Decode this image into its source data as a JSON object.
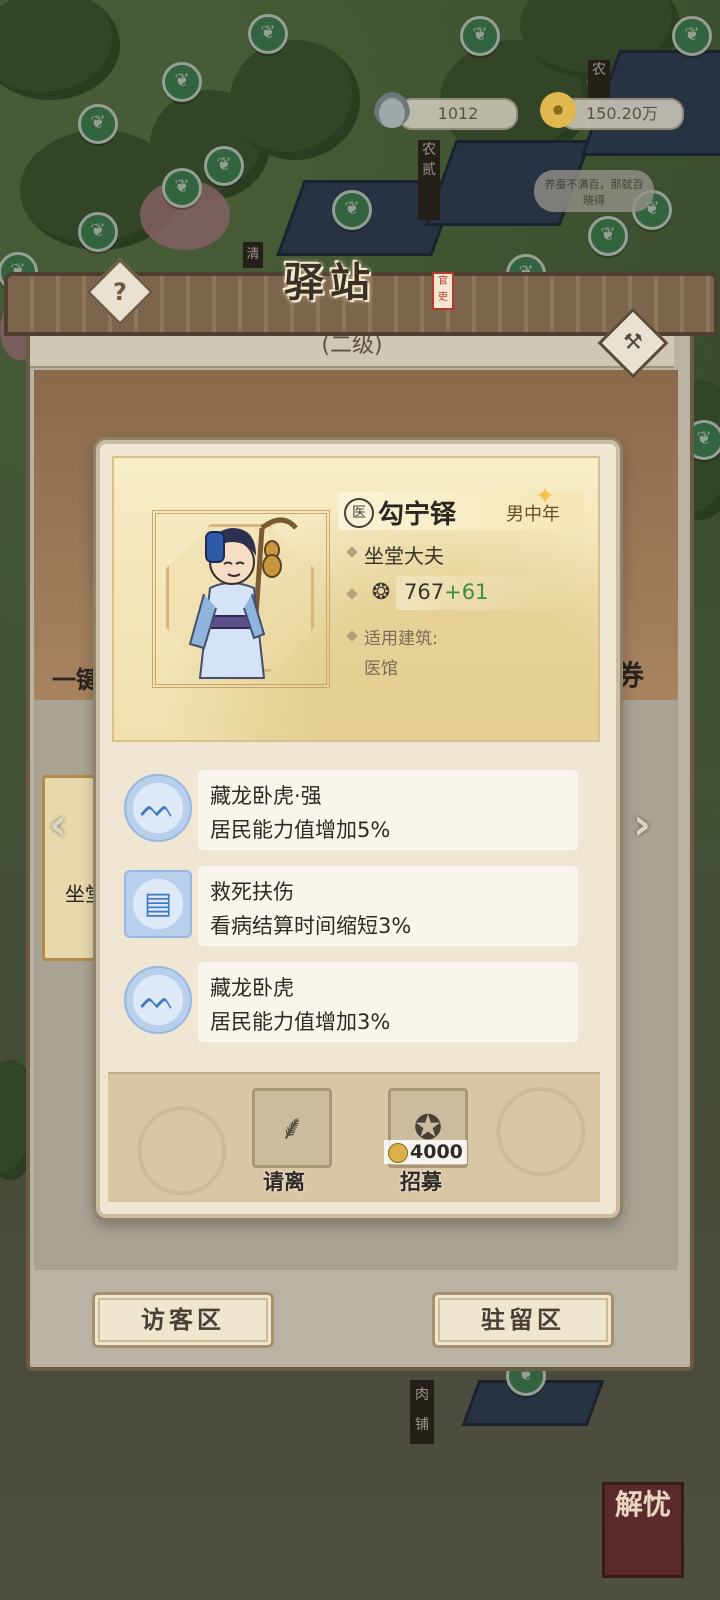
{
  "resources": {
    "pot_value": "1012",
    "coin_value": "150.20万"
  },
  "background_labels": {
    "farm1": "农",
    "farm2": "农",
    "farm2_sub": "贰",
    "qing": "清",
    "speech": "养蚕不满百，那就百晓得",
    "meat": "肉",
    "meat_sub": "铺"
  },
  "station": {
    "title": "驿站",
    "seal": "官吏",
    "help_label": "?",
    "level": "(二级)",
    "left_side_text": "一键",
    "right_side_text": "券",
    "side_card_text": "坐堂",
    "tab_visitor": "访客区",
    "tab_resident": "驻留区",
    "corner_label": "解忧"
  },
  "character": {
    "profession_badge": "医",
    "name": "勾宁铎",
    "gender_age": "男中年",
    "title": "坐堂大夫",
    "power_base": "767",
    "power_bonus": "+61",
    "building_label": "适用建筑:",
    "building": "医馆"
  },
  "skills": [
    {
      "name": "藏龙卧虎·强",
      "desc": "居民能力值增加5%",
      "icon": "tiger-icon"
    },
    {
      "name": "救死扶伤",
      "desc": "看病结算时间缩短3%",
      "icon": "medicine-box-icon"
    },
    {
      "name": "藏龙卧虎",
      "desc": "居民能力值增加3%",
      "icon": "tiger-icon"
    }
  ],
  "actions": {
    "dismiss_label": "请离",
    "recruit_label": "招募",
    "recruit_cost": "4000"
  }
}
